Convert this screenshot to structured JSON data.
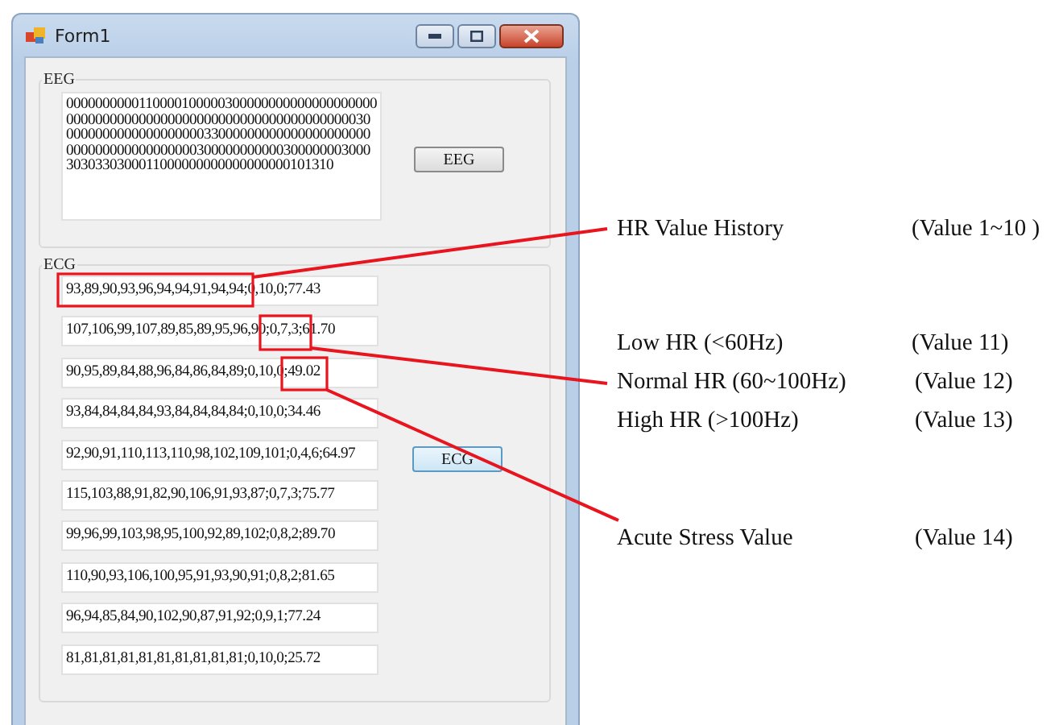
{
  "window": {
    "title": "Form1"
  },
  "eeg": {
    "label": "EEG",
    "text": "00000000001100001000003000000000000000000000000000000000000000000000000000000000000300000000000000000000330000000000000000000000000000000000000003000000000003000000030003030330300011000000000000000000101310",
    "button": "EEG"
  },
  "ecg": {
    "label": "ECG",
    "button": "ECG",
    "rows": [
      "93,89,90,93,96,94,94,91,94,94;0,10,0;77.43",
      "107,106,99,107,89,85,89,95,96,90;0,7,3;61.70",
      "90,95,89,84,88,96,84,86,84,89;0,10,0;49.02",
      "93,84,84,84,84,93,84,84,84,84;0,10,0;34.46",
      "92,90,91,110,113,110,98,102,109,101;0,4,6;64.97",
      "115,103,88,91,82,90,106,91,93,87;0,7,3;75.77",
      "99,96,99,103,98,95,100,92,89,102;0,8,2;89.70",
      "110,90,93,106,100,95,91,93,90,91;0,8,2;81.65",
      "96,94,85,84,90,102,90,87,91,92;0,9,1;77.24",
      "81,81,81,81,81,81,81,81,81,81;0,10,0;25.72"
    ]
  },
  "annotations": [
    {
      "label": "HR Value History",
      "value": "(Value 1~10 )"
    },
    {
      "label": "Low HR (<60Hz)",
      "value": "(Value 11)"
    },
    {
      "label": "Normal HR (60~100Hz)",
      "value": "(Value 12)"
    },
    {
      "label": "High HR (>100Hz)",
      "value": "(Value 13)"
    },
    {
      "label": "Acute Stress Value",
      "value": "(Value 14)"
    }
  ]
}
